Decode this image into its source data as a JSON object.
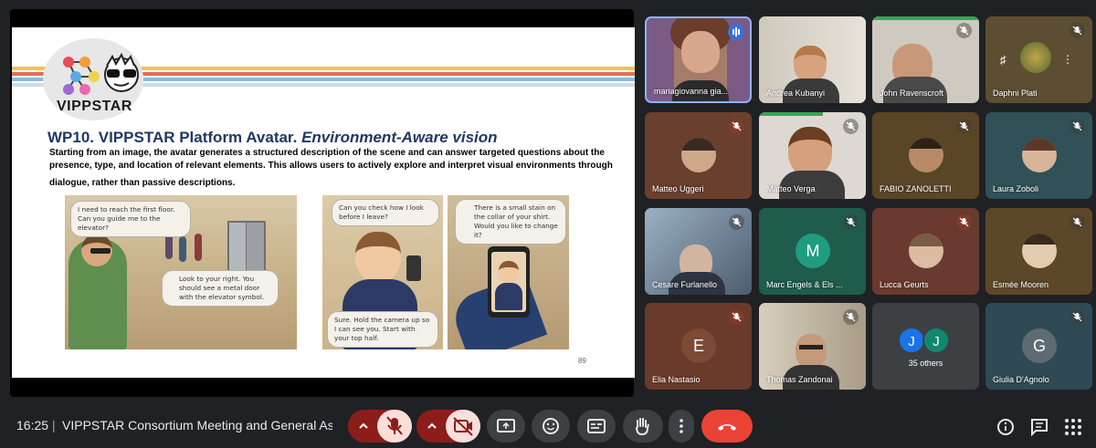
{
  "slide": {
    "logo_text": "VIPPSTAR",
    "title_main": "WP10. VIPPSTAR Platform Avatar.",
    "title_italic": "Environment-Aware vision",
    "body": "Starting from an image, the avatar generates a structured description of the scene and can answer targeted questions about the presence, type, and location of relevant elements. This allows users to actively explore and interpret visual environments through",
    "body_end": "dialogue, rather than passive descriptions.",
    "bubble1": "I need to reach the first floor. Can you guide me to the elevator?",
    "bubble2": "Look to your right. You should see a metal door with the elevator symbol.",
    "bubble3": "Can you check how I look before I leave?",
    "bubble4": "Sure. Hold the camera up so I can see you. Start with your top half.",
    "bubble5": "There is a small stain on the collar of your shirt. Would you like to change it?",
    "page_number": "89"
  },
  "participants": [
    {
      "name": "mariagiovanna gia...",
      "status": "speaking"
    },
    {
      "name": "Andrea Kubanyi"
    },
    {
      "name": "John Ravenscroft",
      "status": "muted"
    },
    {
      "name": "Daphni Plati",
      "status": "muted"
    },
    {
      "name": "Matteo Uggeri",
      "status": "muted"
    },
    {
      "name": "Matteo Verga",
      "status": "muted"
    },
    {
      "name": "FABIO ZANOLETTI",
      "status": "muted"
    },
    {
      "name": "Laura Zoboli",
      "status": "muted"
    },
    {
      "name": "Cesare Furlanello",
      "status": "muted"
    },
    {
      "name": "Marc Engels & Els ...",
      "status": "muted",
      "initial": "M"
    },
    {
      "name": "Lucca Geurts",
      "status": "muted"
    },
    {
      "name": "Esmée Mooren",
      "status": "muted"
    },
    {
      "name": "Elia Nastasio",
      "status": "muted",
      "initial": "E"
    },
    {
      "name": "Thomas Zandonai",
      "status": "muted"
    },
    {
      "name": "35 others",
      "initials": [
        "J",
        "J"
      ]
    },
    {
      "name": "Giulia D'Agnolo",
      "status": "muted",
      "initial": "G"
    }
  ],
  "meeting": {
    "time": "16:25",
    "separator": "|",
    "title": "VIPPSTAR Consortium Meeting and General Ass..."
  },
  "icons": [
    "chevron-up-icon",
    "mic-off-icon",
    "camera-off-icon",
    "present-icon",
    "emoji-icon",
    "captions-icon",
    "raise-hand-icon",
    "more-icon",
    "end-call-icon",
    "info-icon",
    "chat-icon",
    "apps-icon",
    "pin-icon"
  ],
  "colors": {
    "end_call": "#ea4335",
    "muted_button": "#f9dedc",
    "muted_dark": "#8c1d18",
    "bar_bg": "#202124"
  }
}
